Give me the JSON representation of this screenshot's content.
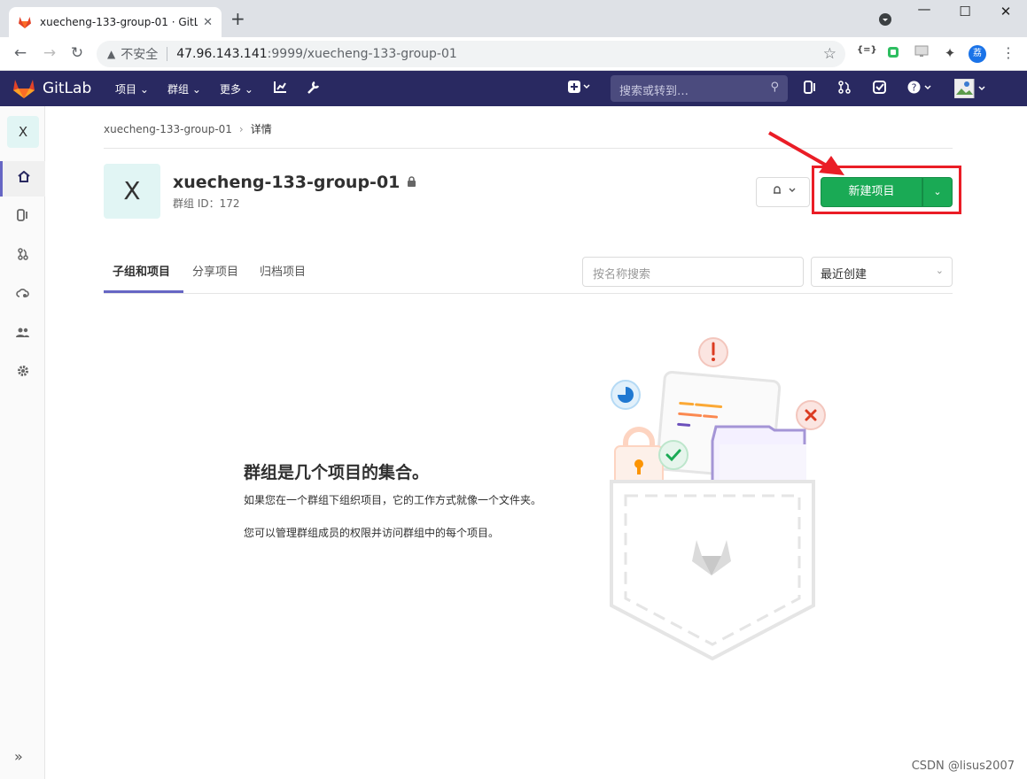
{
  "browser": {
    "tab_title": "xuecheng-133-group-01 · GitL",
    "tab_close": "✕",
    "new_tab": "+",
    "insecure_label": "不安全",
    "url_host": "47.96.143.141",
    "url_path": ":9999/xuecheng-133-group-01",
    "profile_initial": "荔",
    "ext_json": "{=}"
  },
  "header": {
    "brand": "GitLab",
    "nav": [
      {
        "label": "项目"
      },
      {
        "label": "群组"
      },
      {
        "label": "更多"
      }
    ],
    "search_placeholder": "搜索或转到…"
  },
  "breadcrumb": {
    "parent": "xuecheng-133-group-01",
    "current": "详情"
  },
  "group": {
    "avatar_letter": "X",
    "name": "xuecheng-133-group-01",
    "id_text": "群组 ID：172",
    "new_project_button": "新建项目"
  },
  "tabs": [
    {
      "label": "子组和项目",
      "active": true
    },
    {
      "label": "分享项目",
      "active": false
    },
    {
      "label": "归档项目",
      "active": false
    }
  ],
  "filter": {
    "search_placeholder": "按名称搜索",
    "sort_selected": "最近创建"
  },
  "empty_state": {
    "title": "群组是几个项目的集合。",
    "line1": "如果您在一个群组下组织项目，它的工作方式就像一个文件夹。",
    "line2": "您可以管理群组成员的权限并访问群组中的每个项目。"
  },
  "watermark": "CSDN @lisus2007",
  "colors": {
    "header_bg": "#292961",
    "primary_green": "#1aaa55",
    "highlight_red": "#ea1d26",
    "tab_active": "#6666c4"
  }
}
